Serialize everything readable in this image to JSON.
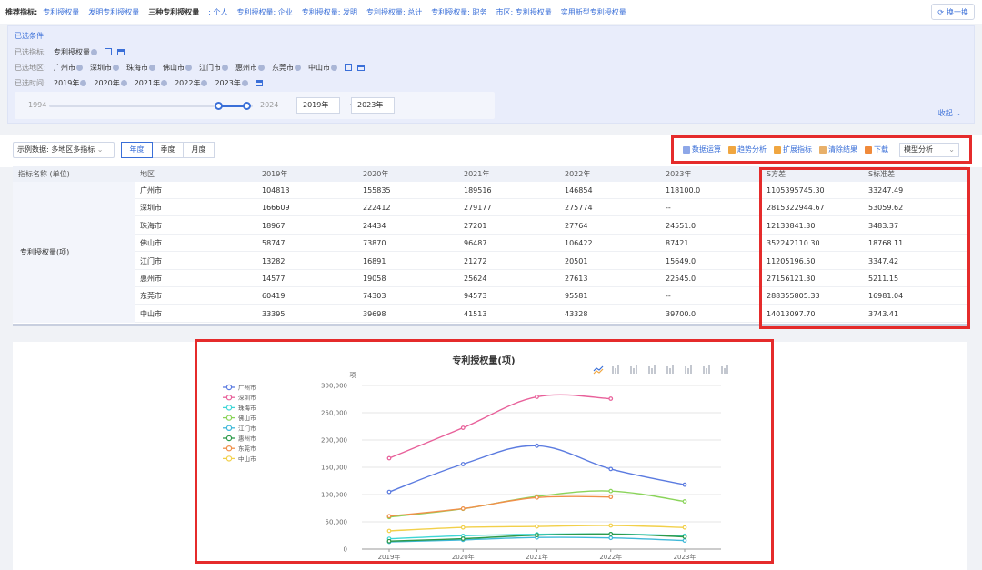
{
  "topbar": {
    "label": "推荐指标:",
    "items": [
      "专利授权量",
      "发明专利授权量",
      "三种专利授权量",
      ": 个人",
      "专利授权量: 企业",
      "专利授权量: 发明",
      "专利授权量: 总计",
      "专利授权量: 职务",
      "市区: 专利授权量",
      "实用新型专利授权量"
    ],
    "switch_label": "换一换"
  },
  "conditions": {
    "title": "已选条件",
    "indicator_label": "已选指标:",
    "indicator": "专利授权量",
    "region_label": "已选地区:",
    "regions": [
      "广州市",
      "深圳市",
      "珠海市",
      "佛山市",
      "江门市",
      "惠州市",
      "东莞市",
      "中山市"
    ],
    "time_label": "已选时间:",
    "times": [
      "2019年",
      "2020年",
      "2021年",
      "2022年",
      "2023年"
    ],
    "range_min": "1994",
    "range_max": "2024",
    "range_start_fraction": 0.83,
    "range_end_fraction": 0.97,
    "start_year": "2019年",
    "end_year": "2023年",
    "range_sep": "-",
    "collapse_label": "收起"
  },
  "toolbar": {
    "sample_label": "示例数据:",
    "sample_value": "多地区多指标",
    "periods": [
      "年度",
      "季度",
      "月度"
    ],
    "active_period": "年度",
    "tools": [
      "数据运算",
      "趋势分析",
      "扩展指标",
      "清除结果",
      "下载"
    ],
    "model_label": "模型分析"
  },
  "table": {
    "headers": [
      "指标名称 (单位)",
      "地区",
      "2019年",
      "2020年",
      "2021年",
      "2022年",
      "2023年",
      "S方差",
      "S标准差"
    ],
    "indicator_name": "专利授权量(项)",
    "rows": [
      [
        "广州市",
        "104813",
        "155835",
        "189516",
        "146854",
        "118100.0",
        "1105395745.30",
        "33247.49"
      ],
      [
        "深圳市",
        "166609",
        "222412",
        "279177",
        "275774",
        "--",
        "2815322944.67",
        "53059.62"
      ],
      [
        "珠海市",
        "18967",
        "24434",
        "27201",
        "27764",
        "24551.0",
        "12133841.30",
        "3483.37"
      ],
      [
        "佛山市",
        "58747",
        "73870",
        "96487",
        "106422",
        "87421",
        "352242110.30",
        "18768.11"
      ],
      [
        "江门市",
        "13282",
        "16891",
        "21272",
        "20501",
        "15649.0",
        "11205196.50",
        "3347.42"
      ],
      [
        "惠州市",
        "14577",
        "19058",
        "25624",
        "27613",
        "22545.0",
        "27156121.30",
        "5211.15"
      ],
      [
        "东莞市",
        "60419",
        "74303",
        "94573",
        "95581",
        "--",
        "288355805.33",
        "16981.04"
      ],
      [
        "中山市",
        "33395",
        "39698",
        "41513",
        "43328",
        "39700.0",
        "14013097.70",
        "3743.41"
      ]
    ]
  },
  "chart_data": {
    "type": "line",
    "title": "专利授权量(项)",
    "ylabel": "项",
    "x": [
      "2019年",
      "2020年",
      "2021年",
      "2022年",
      "2023年"
    ],
    "ylim": [
      0,
      300000
    ],
    "yticks": [
      "0",
      "50,000",
      "100,000",
      "150,000",
      "200,000",
      "250,000",
      "300,000"
    ],
    "legend_position": "left",
    "series": [
      {
        "name": "广州市",
        "color": "#5b7be0",
        "values": [
          104813,
          155835,
          189516,
          146854,
          118100
        ]
      },
      {
        "name": "深圳市",
        "color": "#e8609a",
        "values": [
          166609,
          222412,
          279177,
          275774,
          null
        ]
      },
      {
        "name": "珠海市",
        "color": "#3fd6d6",
        "values": [
          18967,
          24434,
          27201,
          27764,
          24551
        ]
      },
      {
        "name": "佛山市",
        "color": "#8ad45a",
        "values": [
          58747,
          73870,
          96487,
          106422,
          87421
        ]
      },
      {
        "name": "江门市",
        "color": "#3fb8d8",
        "values": [
          13282,
          16891,
          21272,
          20501,
          15649
        ]
      },
      {
        "name": "惠州市",
        "color": "#2e9a4a",
        "values": [
          14577,
          19058,
          25624,
          27613,
          22545
        ]
      },
      {
        "name": "东莞市",
        "color": "#f0904a",
        "values": [
          60419,
          74303,
          94573,
          95581,
          null
        ]
      },
      {
        "name": "中山市",
        "color": "#f2d04a",
        "values": [
          33395,
          39698,
          41513,
          43328,
          39700
        ]
      }
    ],
    "chart_type_icons": [
      "line-chart-icon",
      "bar-chart-icon",
      "stacked-bar-icon",
      "horizontal-bar-icon",
      "stacked-horizontal-icon",
      "area-chart-icon",
      "stacked-area-icon",
      "scatter-icon"
    ]
  }
}
